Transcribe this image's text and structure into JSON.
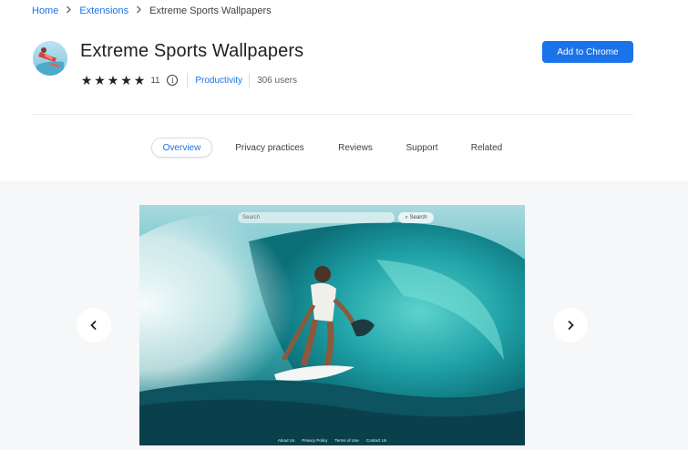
{
  "breadcrumb": {
    "home": "Home",
    "extensions": "Extensions",
    "current": "Extreme Sports Wallpapers"
  },
  "extension": {
    "title": "Extreme Sports Wallpapers",
    "rating": 5,
    "rating_count": "11",
    "category": "Productivity",
    "users": "306 users",
    "add_button": "Add to Chrome"
  },
  "tabs": [
    {
      "label": "Overview",
      "active": true
    },
    {
      "label": "Privacy practices",
      "active": false
    },
    {
      "label": "Reviews",
      "active": false
    },
    {
      "label": "Support",
      "active": false
    },
    {
      "label": "Related",
      "active": false
    }
  ],
  "screenshot": {
    "search_placeholder": "Search",
    "search_button": "Search",
    "footer_links": [
      "About Us",
      "Privacy Policy",
      "Terms of Use",
      "Contact Us"
    ]
  },
  "colors": {
    "accent": "#1a73e8",
    "gallery_bg": "#f6f7f8"
  }
}
